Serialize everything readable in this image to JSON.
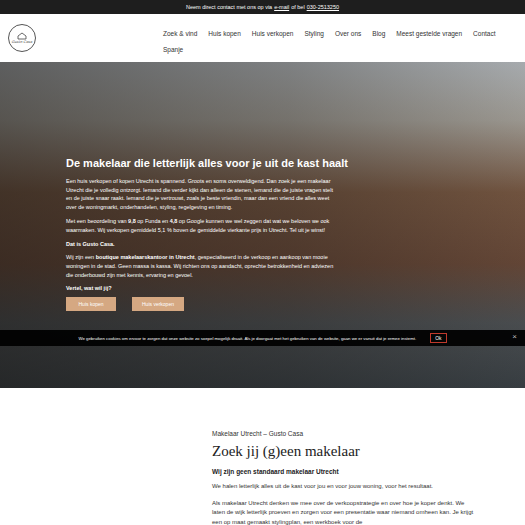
{
  "top_bar": {
    "text_before": "Neem direct contact met ons op via",
    "email_link": "e-mail",
    "text_middle": "of bel",
    "phone_link": "030-2513250"
  },
  "logo": {
    "text": "Gusto Casa"
  },
  "nav": [
    {
      "label": "Zoek & vind"
    },
    {
      "label": "Huis kopen"
    },
    {
      "label": "Huis verkopen"
    },
    {
      "label": "Styling"
    },
    {
      "label": "Over ons"
    },
    {
      "label": "Blog"
    },
    {
      "label": "Meest gestelde vragen"
    },
    {
      "label": "Contact"
    },
    {
      "label": "Spanje"
    }
  ],
  "hero": {
    "heading": "De makelaar die letterlijk alles voor je uit de kast haalt",
    "paragraphs": [
      [
        {
          "text": "Een huis verkopen of kopen Utrecht is spannend. Groots en soms overweldigend. Dan zoek je een makelaar Utrecht die je volledig ontzorgt. Iemand die verder kijkt dan alleen de stenen, iemand die de juiste vragen stelt en de juiste snaar raakt. Iemand die je vertrouwt, zoals je beste vriendin, maar dan een vriend die alles weet over de woningmarkt, onderhandelen, styling, regelgeving en timing.",
          "bold": false
        }
      ],
      [
        {
          "text": "Met een beoordeling van ",
          "bold": false
        },
        {
          "text": "9,8",
          "bold": true
        },
        {
          "text": " op Funda en ",
          "bold": false
        },
        {
          "text": "4,8",
          "bold": true
        },
        {
          "text": " op Google kunnen we wel zeggen dat wat we beloven we ook waarmaken. Wij verkopen gemiddeld 5,1 % boven de gemiddelde vierkante prijs in Utrecht. Tel uit je winst!",
          "bold": false
        }
      ],
      [
        {
          "text": "Dat is Gusto Casa.",
          "bold": true
        }
      ],
      [
        {
          "text": "Wij zijn een ",
          "bold": false
        },
        {
          "text": "boutique makelaarskantoor in Utrecht",
          "bold": true
        },
        {
          "text": ", gespecialiseerd in de verkoop en aankoop van mooie woningen in de stad. Geen massa is kassa. Wij richten ons op aandacht, oprechte betrokkenheid en adviezen die onderbouwd zijn met kennis, ervaring en gevoel.",
          "bold": false
        }
      ]
    ],
    "question": "Vertel, wat wil jij?",
    "buttons": [
      "Huis kopen",
      "Huis verkopen"
    ]
  },
  "cookie_bar": {
    "text": "We gebruiken cookies om ervoor te zorgen dat onze website zo soepel mogelijk draait. Als je doorgaat met het gebruiken van de website, gaan we er vanuit dat je ermee instemt.",
    "button": "Ok",
    "close": "×"
  },
  "intro": {
    "kicker": "Makelaar Utrecht – Gusto Casa",
    "heading": "Zoek jij (g)een makelaar",
    "subheading": "Wij zijn geen standaard makelaar Utrecht",
    "paragraphs": [
      "We halen letterlijk alles uit de kast voor jou en voor jouw woning, voor het resultaat.",
      "Als makelaar Utrecht denken we mee over de verkoopstrategie en over hoe je koper denkt. We laten de wijk letterlijk proeven en zorgen voor een presentatie waar niemand omheen kan. Je krijgt een op maat gemaakt stylingplan, een werkboek voor de"
    ]
  }
}
